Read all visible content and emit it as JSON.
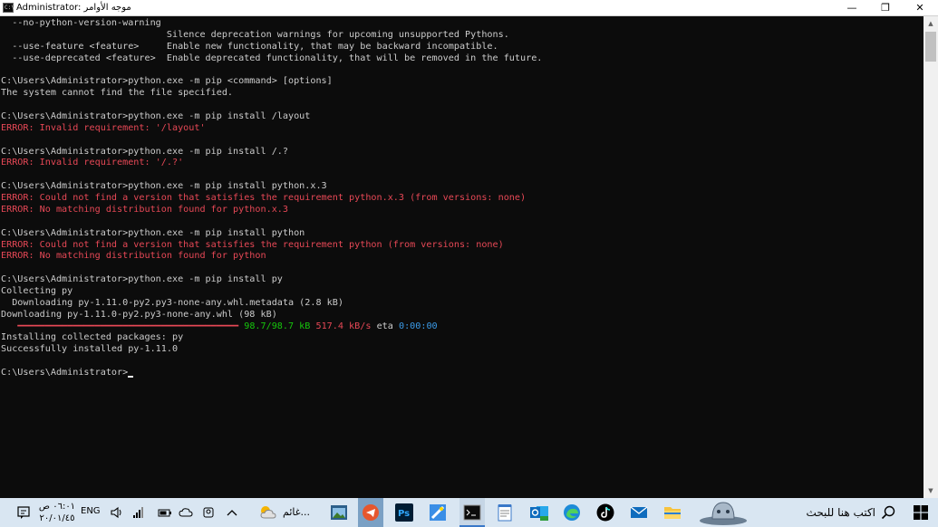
{
  "window": {
    "title": "Administrator: موجه الأوامر",
    "icon_label": "C:\\",
    "minimize": "—",
    "restore": "❐",
    "close": "✕"
  },
  "terminal_lines": [
    {
      "text": "  --no-python-version-warning",
      "style": "normal"
    },
    {
      "text": "                              Silence deprecation warnings for upcoming unsupported Pythons.",
      "style": "normal"
    },
    {
      "text": "  --use-feature <feature>     Enable new functionality, that may be backward incompatible.",
      "style": "normal"
    },
    {
      "text": "  --use-deprecated <feature>  Enable deprecated functionality, that will be removed in the future.",
      "style": "normal"
    },
    {
      "text": "",
      "style": "normal"
    },
    {
      "text": "C:\\Users\\Administrator>python.exe -m pip <command> [options]",
      "style": "normal"
    },
    {
      "text": "The system cannot find the file specified.",
      "style": "normal"
    },
    {
      "text": "",
      "style": "normal"
    },
    {
      "text": "C:\\Users\\Administrator>python.exe -m pip install /layout",
      "style": "normal"
    },
    {
      "text": "ERROR: Invalid requirement: '/layout'",
      "style": "error"
    },
    {
      "text": "",
      "style": "normal"
    },
    {
      "text": "C:\\Users\\Administrator>python.exe -m pip install /.?",
      "style": "normal"
    },
    {
      "text": "ERROR: Invalid requirement: '/.?'",
      "style": "error"
    },
    {
      "text": "",
      "style": "normal"
    },
    {
      "text": "C:\\Users\\Administrator>python.exe -m pip install python.x.3",
      "style": "normal"
    },
    {
      "text": "ERROR: Could not find a version that satisfies the requirement python.x.3 (from versions: none)",
      "style": "error"
    },
    {
      "text": "ERROR: No matching distribution found for python.x.3",
      "style": "error"
    },
    {
      "text": "",
      "style": "normal"
    },
    {
      "text": "C:\\Users\\Administrator>python.exe -m pip install python",
      "style": "normal"
    },
    {
      "text": "ERROR: Could not find a version that satisfies the requirement python (from versions: none)",
      "style": "error"
    },
    {
      "text": "ERROR: No matching distribution found for python",
      "style": "error"
    },
    {
      "text": "",
      "style": "normal"
    },
    {
      "text": "C:\\Users\\Administrator>python.exe -m pip install py",
      "style": "normal"
    },
    {
      "text": "Collecting py",
      "style": "normal"
    },
    {
      "text": "  Downloading py-1.11.0-py2.py3-none-any.whl.metadata (2.8 kB)",
      "style": "normal"
    },
    {
      "text": "Downloading py-1.11.0-py2.py3-none-any.whl (98 kB)",
      "style": "normal"
    },
    {
      "text": "",
      "style": "progress"
    },
    {
      "text": "Installing collected packages: py",
      "style": "normal"
    },
    {
      "text": "Successfully installed py-1.11.0",
      "style": "normal"
    },
    {
      "text": "",
      "style": "normal"
    },
    {
      "text": "C:\\Users\\Administrator>",
      "style": "prompt"
    }
  ],
  "progress": {
    "bar": "   ━━━━━━━━━━━━━━━━━━━━━━━━━━━━━━━━━━━━━━━━ ",
    "size": "98.7/98.7 kB",
    "speed": "517.4 kB/s",
    "eta_label": "eta",
    "eta": "0:00:00",
    "fraction": 1.0
  },
  "colors": {
    "background": "#0c0c0c",
    "text": "#cccccc",
    "error": "#e74856",
    "progress_green": "#16c60c",
    "taskbar": "#d9e6f2"
  },
  "taskbar": {
    "search_placeholder": "اكتب هنا للبحث",
    "language": "ENG",
    "clock_time": "٠٦:٠١ ص",
    "clock_date": "٢٠/٠١/٤٥",
    "weather": "غائم...",
    "icons": [
      "windows-start-icon",
      "search-icon",
      "cortana-icon",
      "mail-icon",
      "tiktok-icon",
      "edge-icon",
      "outlook-icon",
      "notepad-icon",
      "terminal-icon",
      "paint-icon",
      "photoshop-icon",
      "telegram-icon",
      "explorer-icon",
      "weather-icon",
      "chevron-up-icon",
      "people-icon",
      "cloud-icon",
      "speaker-icon",
      "network-icon",
      "notification-icon"
    ]
  }
}
